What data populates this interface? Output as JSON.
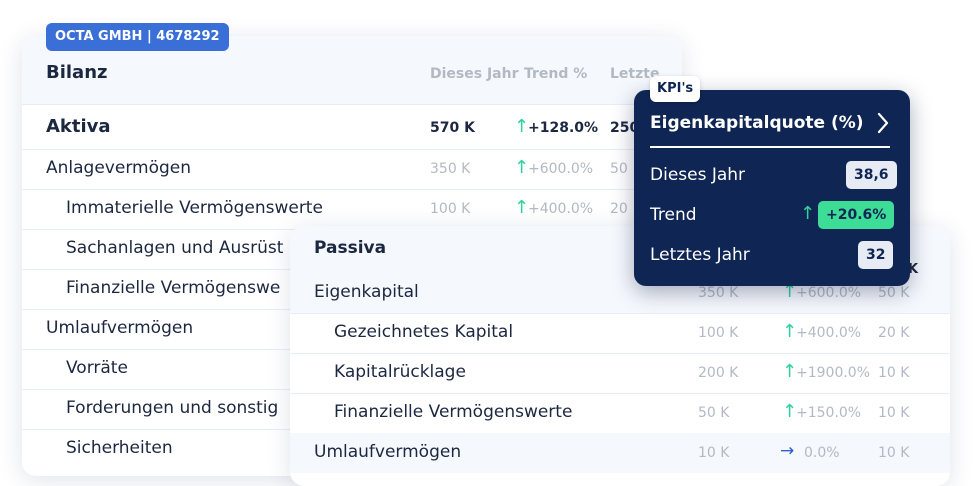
{
  "company_badge": "OCTA GMBH | 4678292",
  "bilanz": {
    "title": "Bilanz",
    "columns": [
      "Dieses Jahr",
      "Trend %",
      "Letzte"
    ],
    "aktiva": {
      "label": "Aktiva",
      "value": "570 K",
      "trend": "+128.0%",
      "last": "250"
    },
    "rows": [
      {
        "label": "Anlagevermögen",
        "value": "350 K",
        "trend": "+600.0%",
        "last": "50"
      },
      {
        "label": "Immaterielle Vermögenswerte",
        "value": "100 K",
        "trend": "+400.0%",
        "last": "20"
      },
      {
        "label": "Sachanlagen und Ausrüst",
        "value": "",
        "trend": "",
        "last": ""
      },
      {
        "label": "Finanzielle Vermögenswe",
        "value": "",
        "trend": "",
        "last": ""
      },
      {
        "label": "Umlaufvermögen",
        "value": "",
        "trend": "",
        "last": ""
      },
      {
        "label": "Vorräte",
        "value": "",
        "trend": "",
        "last": ""
      },
      {
        "label": "Forderungen und sonstig",
        "value": "",
        "trend": "",
        "last": ""
      },
      {
        "label": "Sicherheiten",
        "value": "",
        "trend": "",
        "last": ""
      }
    ]
  },
  "passiva": {
    "title": "Passiva",
    "header_k": "K",
    "rows": [
      {
        "label": "Eigenkapital",
        "value": "350 K",
        "trend": "+600.0%",
        "last": "50 K"
      },
      {
        "label": "Gezeichnetes Kapital",
        "value": "100 K",
        "trend": "+400.0%",
        "last": "20 K"
      },
      {
        "label": "Kapitalrücklage",
        "value": "200 K",
        "trend": "+1900.0%",
        "last": "10 K"
      },
      {
        "label": "Finanzielle Vermögenswerte",
        "value": "50 K",
        "trend": "+150.0%",
        "last": "10 K"
      },
      {
        "label": "Umlaufvermögen",
        "value": "10 K",
        "trend": "0.0%",
        "last": "10 K"
      }
    ]
  },
  "kpi": {
    "tag": "KPI's",
    "title": "Eigenkapitalquote (%)",
    "this_year_label": "Dieses Jahr",
    "this_year_value": "38,6",
    "trend_label": "Trend",
    "trend_value": "+20.6%",
    "last_year_label": "Letztes Jahr",
    "last_year_value": "32"
  },
  "icons": {
    "up": "arrow-up-icon",
    "right": "arrow-right-icon",
    "chevron": "chevron-right-icon"
  }
}
